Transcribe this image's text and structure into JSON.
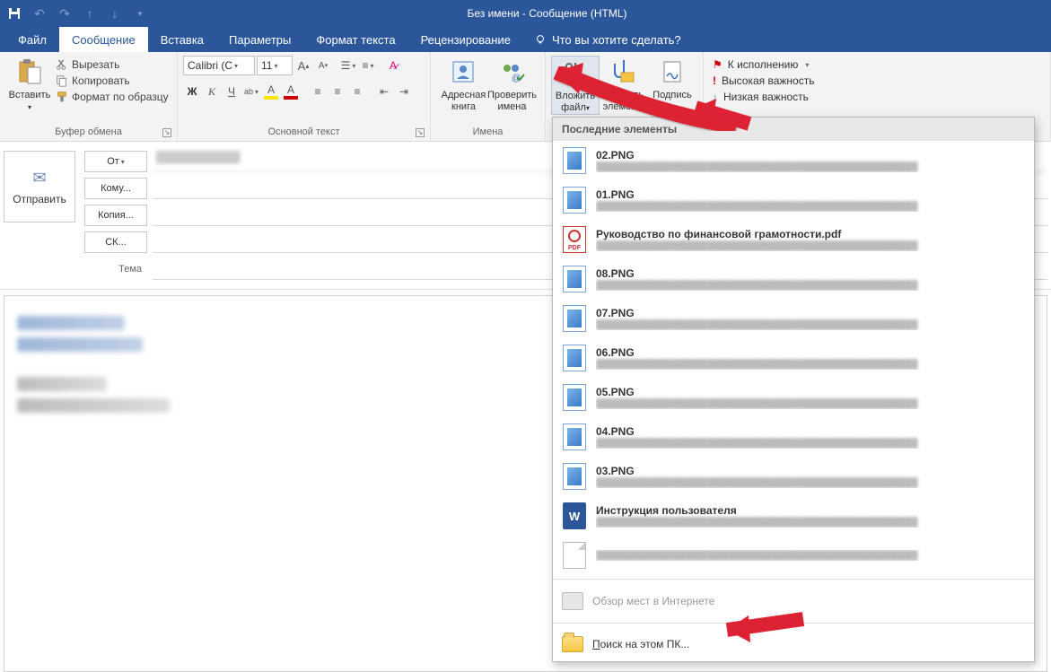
{
  "window_title": "Без имени - Сообщение (HTML)",
  "tabs": {
    "file": "Файл",
    "message": "Сообщение",
    "insert": "Вставка",
    "options": "Параметры",
    "format": "Формат текста",
    "review": "Рецензирование",
    "tellme": "Что вы хотите сделать?"
  },
  "groups": {
    "clipboard": "Буфер обмена",
    "basictext": "Основной текст",
    "names": "Имена"
  },
  "clipboard": {
    "paste": "Вставить",
    "cut": "Вырезать",
    "copy": "Копировать",
    "painter": "Формат по образцу"
  },
  "font": {
    "name": "Calibri (С",
    "size": "11"
  },
  "names": {
    "address_book": "Адресная книга",
    "check_names": "Проверить имена"
  },
  "include": {
    "attach_file": "Вложить файл",
    "attach_item": "Вложить элемент",
    "signature": "Подпись"
  },
  "tags": {
    "followup": "К исполнению",
    "high": "Высокая важность",
    "low": "Низкая важность"
  },
  "compose": {
    "send": "Отправить",
    "from": "От",
    "to": "Кому...",
    "cc": "Копия...",
    "bcc": "СК...",
    "subject": "Тема"
  },
  "dropdown": {
    "header": "Последние элементы",
    "items": [
      {
        "name": "02.PNG",
        "type": "img"
      },
      {
        "name": "01.PNG",
        "type": "img"
      },
      {
        "name": "Руководство по финансовой грамотности.pdf",
        "type": "pdf"
      },
      {
        "name": "08.PNG",
        "type": "img"
      },
      {
        "name": "07.PNG",
        "type": "img"
      },
      {
        "name": "06.PNG",
        "type": "img"
      },
      {
        "name": "05.PNG",
        "type": "img"
      },
      {
        "name": "04.PNG",
        "type": "img"
      },
      {
        "name": "03.PNG",
        "type": "img"
      },
      {
        "name": "Инструкция пользователя",
        "type": "doc"
      },
      {
        "name": "",
        "type": "blank"
      }
    ],
    "browse_web": "Обзор мест в Интернете",
    "browse_pc_prefix": "П",
    "browse_pc_rest": "оиск на этом ПК..."
  }
}
